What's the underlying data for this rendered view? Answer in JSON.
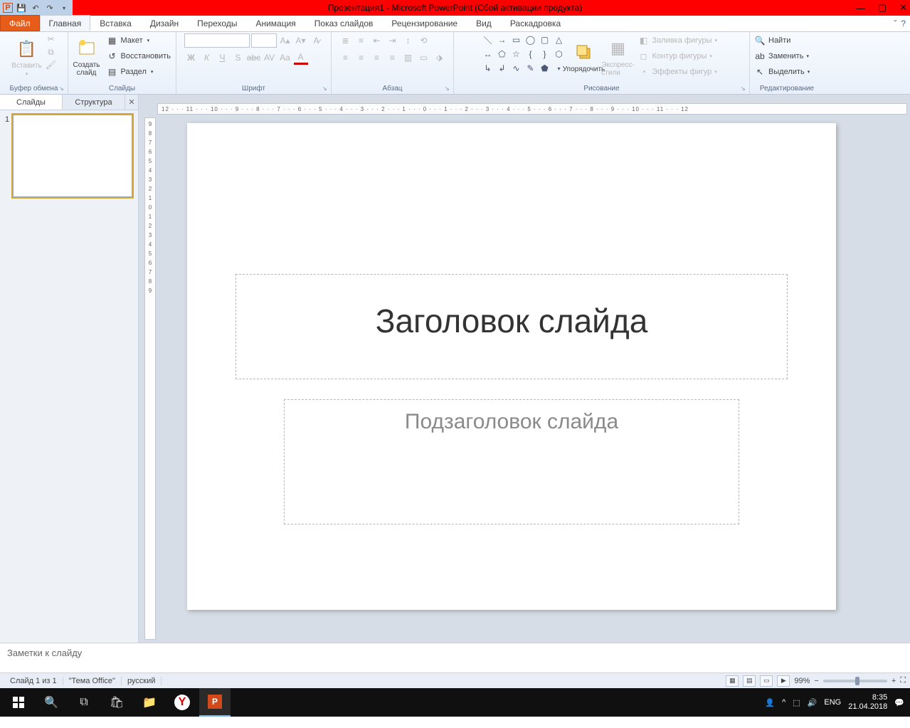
{
  "title": "Презентация1 - Microsoft PowerPoint (Сбой активации продукта)",
  "tabs": {
    "file": "Файл",
    "items": [
      "Главная",
      "Вставка",
      "Дизайн",
      "Переходы",
      "Анимация",
      "Показ слайдов",
      "Рецензирование",
      "Вид",
      "Раскадровка"
    ],
    "activeIndex": 0
  },
  "groups": {
    "clipboard": {
      "label": "Буфер обмена",
      "paste": "Вставить"
    },
    "slides": {
      "label": "Слайды",
      "new": "Создать\nслайд",
      "layout": "Макет",
      "reset": "Восстановить",
      "section": "Раздел"
    },
    "font": {
      "label": "Шрифт",
      "font": "",
      "size": ""
    },
    "paragraph": {
      "label": "Абзац"
    },
    "drawing": {
      "label": "Рисование",
      "arrange": "Упорядочить",
      "quick": "Экспресс-стили",
      "fill": "Заливка фигуры",
      "outline": "Контур фигуры",
      "effects": "Эффекты фигур"
    },
    "editing": {
      "label": "Редактирование",
      "find": "Найти",
      "replace": "Заменить",
      "select": "Выделить"
    }
  },
  "leftTabs": {
    "slides": "Слайды",
    "outline": "Структура"
  },
  "thumb": {
    "num": "1"
  },
  "rulerH": "12 · · · 11 · · · 10 · · · 9 · · · 8 · · · 7 · · · 6 · · · 5 · · · 4 · · · 3 · · · 2 · · · 1 · · · 0 · · · 1 · · · 2 · · · 3 · · · 4 · · · 5 · · · 6 · · · 7 · · · 8 · · · 9 · · · 10 · · · 11 · · · 12",
  "rulerV": [
    "9",
    "8",
    "7",
    "6",
    "5",
    "4",
    "3",
    "2",
    "1",
    "0",
    "1",
    "2",
    "3",
    "4",
    "5",
    "6",
    "7",
    "8",
    "9"
  ],
  "slide": {
    "title": "Заголовок слайда",
    "subtitle": "Подзаголовок слайда"
  },
  "notes": "Заметки к слайду",
  "status": {
    "slide": "Слайд 1 из 1",
    "theme": "\"Тема Office\"",
    "lang": "русский",
    "zoom": "99%"
  },
  "taskbar": {
    "lang": "ENG",
    "time": "8:35",
    "date": "21.04.2018"
  }
}
